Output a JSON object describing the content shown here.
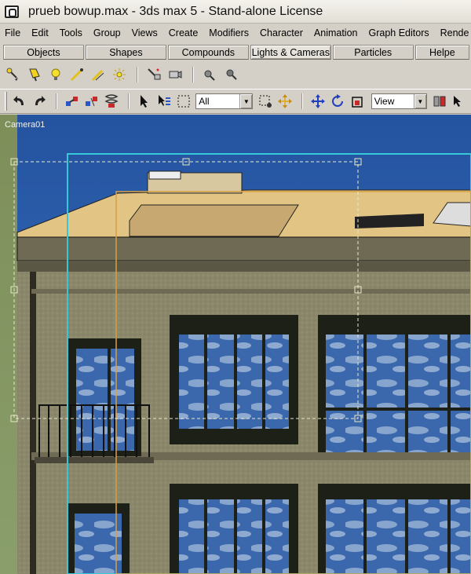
{
  "window": {
    "title": "prueb bowup.max - 3ds max 5 - Stand-alone License"
  },
  "menu": [
    "File",
    "Edit",
    "Tools",
    "Group",
    "Views",
    "Create",
    "Modifiers",
    "Character",
    "Animation",
    "Graph Editors",
    "Rende"
  ],
  "tabs": [
    {
      "label": "Objects",
      "active": false
    },
    {
      "label": "Shapes",
      "active": false
    },
    {
      "label": "Compounds",
      "active": false
    },
    {
      "label": "Lights & Cameras",
      "active": true
    },
    {
      "label": "Particles",
      "active": false
    },
    {
      "label": "Helpe",
      "active": false
    }
  ],
  "command_icons": [
    "target-spot-light-icon",
    "free-spot-light-icon",
    "omni-light-icon",
    "target-direct-light-icon",
    "free-direct-light-icon",
    "skylight-icon",
    "target-camera-icon",
    "free-camera-icon",
    "sunlight-icon",
    "daylight-icon"
  ],
  "toolbar": {
    "selection_filter": "All",
    "reference_coord": "View"
  },
  "viewport": {
    "label": "Camera01"
  },
  "colors": {
    "sky": "#2a5ea8",
    "facade": "#8e8a6e",
    "roof": "#e2c584",
    "frame_yellow": "#c8c020",
    "guide_cyan": "#35c8d8",
    "guide_orange": "#d8a040"
  }
}
